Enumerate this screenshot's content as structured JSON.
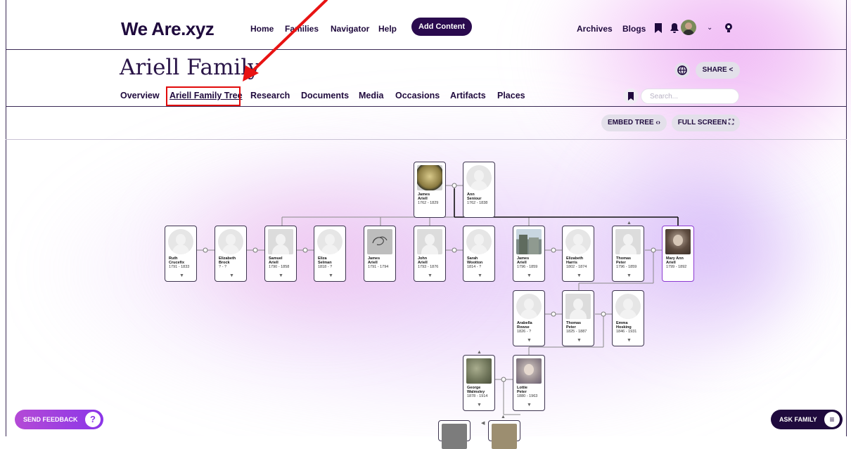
{
  "header": {
    "logo": "We Are.xyz",
    "nav": [
      "Home",
      "Families",
      "Navigator",
      "Help"
    ],
    "add_content": "Add Content",
    "right_links": [
      "Archives",
      "Blogs"
    ]
  },
  "family": {
    "title": "Ariell Family",
    "share": "SHARE",
    "tabs": [
      "Overview",
      "Ariell Family Tree",
      "Research",
      "Documents",
      "Media",
      "Occasions",
      "Artifacts",
      "Places"
    ],
    "search_placeholder": "Search...",
    "embed_tree": "EMBED TREE",
    "full_screen": "FULL SCREEN"
  },
  "tree": {
    "people": [
      {
        "id": "ja1",
        "first": "James",
        "last": "Ariell",
        "dates": "1762 - 1829",
        "photo": "coin"
      },
      {
        "id": "as",
        "first": "Ann",
        "last": "Seniour",
        "dates": "1762 - 1838",
        "photo": "silhouette"
      },
      {
        "id": "rc",
        "first": "Ruth",
        "last": "Crucefix",
        "dates": "1791 - 1833",
        "photo": "silhouette"
      },
      {
        "id": "eb",
        "first": "Elizabeth",
        "last": "Brock",
        "dates": "? - ?",
        "photo": "silhouette"
      },
      {
        "id": "sa",
        "first": "Samuel",
        "last": "Ariell",
        "dates": "1790 - 1858",
        "photo": "silhouette-square"
      },
      {
        "id": "es",
        "first": "Eliza",
        "last": "Selman",
        "dates": "1818 - ?",
        "photo": "silhouette"
      },
      {
        "id": "ja2",
        "first": "James",
        "last": "Ariell",
        "dates": "1791 - 1794",
        "photo": "sketch"
      },
      {
        "id": "jna",
        "first": "John",
        "last": "Ariell",
        "dates": "1793 - 1876",
        "photo": "silhouette-square"
      },
      {
        "id": "sw",
        "first": "Sarah",
        "last": "Wootton",
        "dates": "1814 - ?",
        "photo": "silhouette"
      },
      {
        "id": "ja3",
        "first": "James",
        "last": "Ariell",
        "dates": "1796 - 1859",
        "photo": "building"
      },
      {
        "id": "eh",
        "first": "Elizabeth",
        "last": "Harris",
        "dates": "1802 - 1874",
        "photo": "silhouette"
      },
      {
        "id": "tp1",
        "first": "Thomas",
        "last": "Peter",
        "dates": "1796 - 1859",
        "photo": "silhouette-square"
      },
      {
        "id": "maa",
        "first": "Mary Ann",
        "last": "Ariell",
        "dates": "1799 - 1892",
        "photo": "portrait"
      },
      {
        "id": "ar",
        "first": "Arabella",
        "last": "Rowse",
        "dates": "1826 - ?",
        "photo": "silhouette"
      },
      {
        "id": "tp2",
        "first": "Thomas",
        "last": "Peter",
        "dates": "1825 - 1887",
        "photo": "silhouette-square"
      },
      {
        "id": "eho",
        "first": "Emma",
        "last": "Hosking",
        "dates": "1846 - 1931",
        "photo": "silhouette"
      },
      {
        "id": "gw",
        "first": "George",
        "last": "Walmsley",
        "dates": "1878 - 1914",
        "photo": "stone"
      },
      {
        "id": "lp",
        "first": "Lottie",
        "last": "Peter",
        "dates": "1880 - 1963",
        "photo": "portrait2"
      }
    ]
  },
  "footer": {
    "send_feedback": "SEND FEEDBACK",
    "ask_family": "ASK FAMILY"
  },
  "colors": {
    "brand_dark": "#1f0a3d",
    "highlight_red": "#e10a0a",
    "selected_border": "#8c3bd1"
  }
}
